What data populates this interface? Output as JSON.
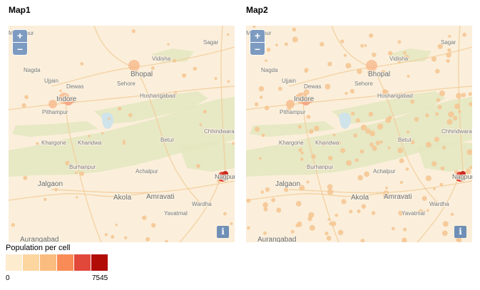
{
  "maps": [
    {
      "title": "Map1",
      "zoom_in_label": "+",
      "zoom_out_label": "–",
      "info_label": "i",
      "dot_density": "low",
      "hotspot_color": "#e14a3b"
    },
    {
      "title": "Map2",
      "zoom_in_label": "+",
      "zoom_out_label": "–",
      "info_label": "i",
      "dot_density": "high",
      "hotspot_color": "#e14a3b"
    }
  ],
  "place_labels": [
    "Mandsaur",
    "Sagar",
    "Vidisha",
    "Nagda",
    "Bhopal",
    "Ujjain",
    "Dewas",
    "Sehore",
    "Hoshangabad",
    "Indore",
    "Pithampur",
    "Chhindwara",
    "Betul",
    "Khargone",
    "Khandwa",
    "Burhanpur",
    "Achalpur",
    "Nagpur",
    "Jalgaon",
    "Akola",
    "Amravati",
    "Wardha",
    "Yavatmal",
    "Aurangabad"
  ],
  "legend": {
    "title": "Population per cell",
    "min_label": "0",
    "max_label": "7545",
    "colors": [
      "#feeccf",
      "#fcd59f",
      "#fbbc7f",
      "#f98b56",
      "#e2483a",
      "#b20c06"
    ]
  },
  "colors": {
    "land": "#fbefdb",
    "forest": "#e3e6bf",
    "water": "#cfe3ea",
    "road": "#f2cc98",
    "dot": "#f5c491",
    "control": "#7d9bc1"
  }
}
